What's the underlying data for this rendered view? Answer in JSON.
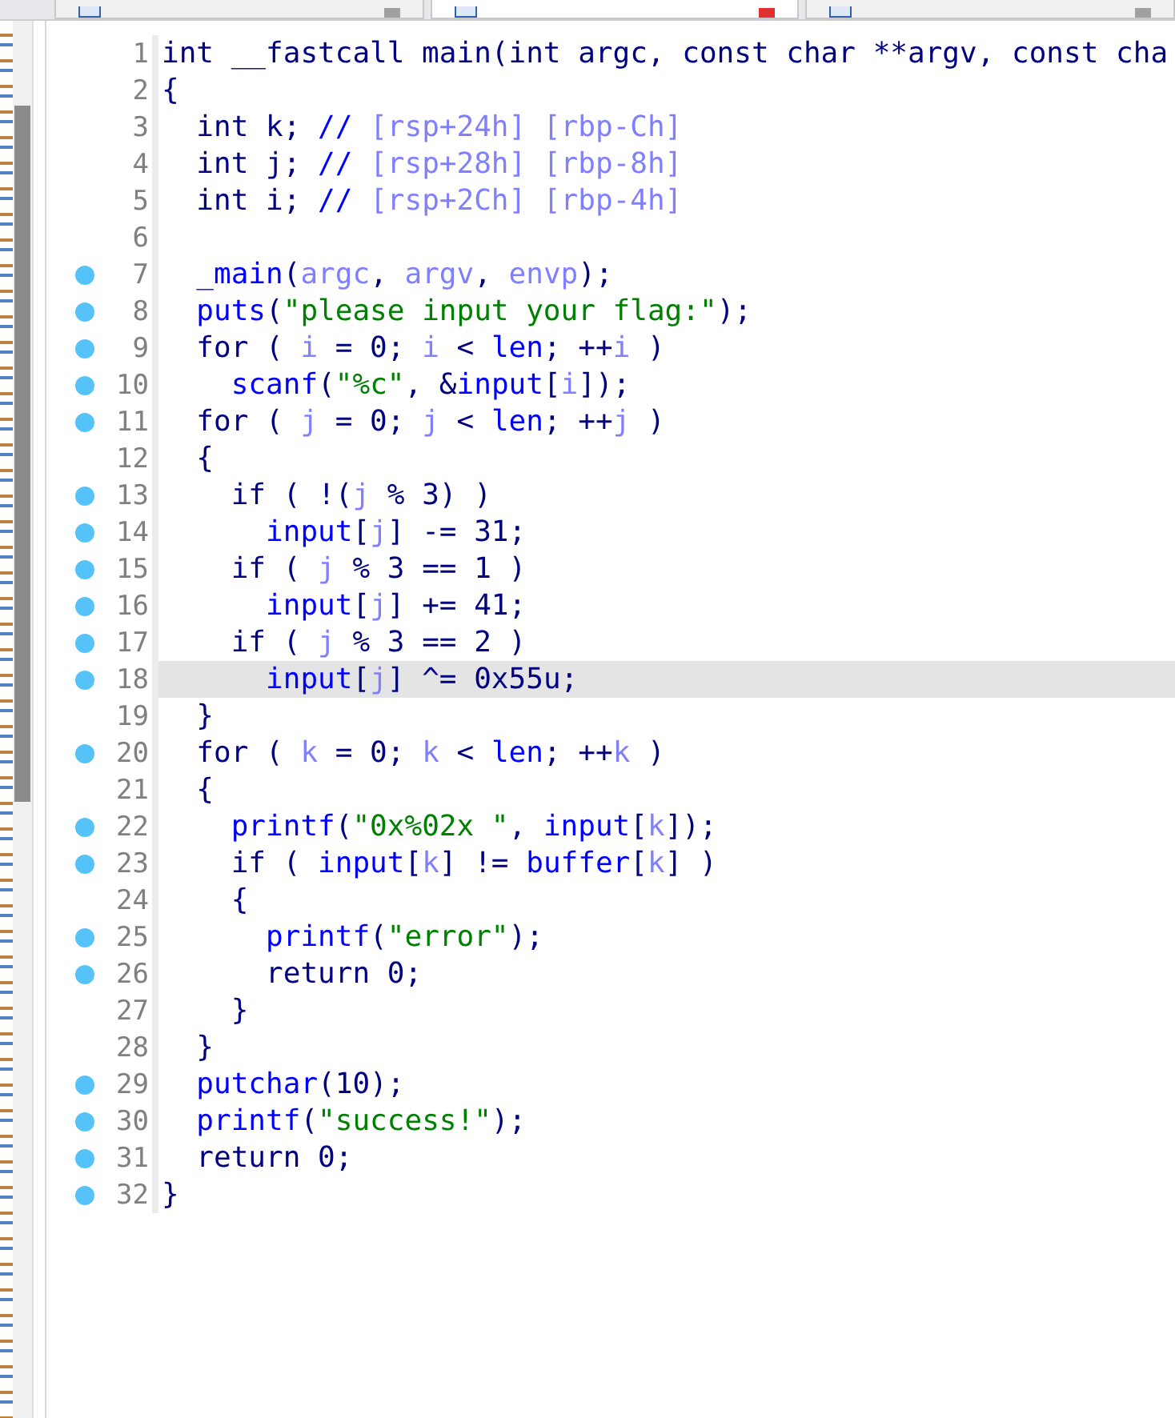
{
  "tabs": [
    {
      "selected": false
    },
    {
      "selected": true
    },
    {
      "selected": false
    }
  ],
  "lines": [
    {
      "number": "1",
      "breakpoint": false,
      "highlighted": false,
      "tokens": [
        {
          "text": "int __fastcall main(int argc, const char **argv, const cha",
          "kind": "plain"
        }
      ]
    },
    {
      "number": "2",
      "breakpoint": false,
      "highlighted": false,
      "tokens": [
        {
          "text": "{",
          "kind": "plain"
        }
      ]
    },
    {
      "number": "3",
      "breakpoint": false,
      "highlighted": false,
      "tokens": [
        {
          "text": "  int k; ",
          "kind": "plain"
        },
        {
          "text": "// ",
          "kind": "func"
        },
        {
          "text": "[rsp+24h] [rbp-Ch]",
          "kind": "var"
        }
      ]
    },
    {
      "number": "4",
      "breakpoint": false,
      "highlighted": false,
      "tokens": [
        {
          "text": "  int j; ",
          "kind": "plain"
        },
        {
          "text": "// ",
          "kind": "func"
        },
        {
          "text": "[rsp+28h] [rbp-8h]",
          "kind": "var"
        }
      ]
    },
    {
      "number": "5",
      "breakpoint": false,
      "highlighted": false,
      "tokens": [
        {
          "text": "  int i; ",
          "kind": "plain"
        },
        {
          "text": "// ",
          "kind": "func"
        },
        {
          "text": "[rsp+2Ch] [rbp-4h]",
          "kind": "var"
        }
      ]
    },
    {
      "number": "6",
      "breakpoint": false,
      "highlighted": false
    },
    {
      "number": "7",
      "breakpoint": true,
      "highlighted": false,
      "tokens": [
        {
          "text": "  _main",
          "kind": "func"
        },
        {
          "text": "(",
          "kind": "plain"
        },
        {
          "text": "argc",
          "kind": "var"
        },
        {
          "text": ", ",
          "kind": "plain"
        },
        {
          "text": "argv",
          "kind": "var"
        },
        {
          "text": ", ",
          "kind": "plain"
        },
        {
          "text": "envp",
          "kind": "var"
        },
        {
          "text": ");",
          "kind": "plain"
        }
      ]
    },
    {
      "number": "8",
      "breakpoint": true,
      "highlighted": false,
      "tokens": [
        {
          "text": "  puts",
          "kind": "func"
        },
        {
          "text": "(",
          "kind": "plain"
        },
        {
          "text": "\"please input your flag:\"",
          "kind": "string"
        },
        {
          "text": ");",
          "kind": "plain"
        }
      ]
    },
    {
      "number": "9",
      "breakpoint": true,
      "highlighted": false,
      "tokens": [
        {
          "text": "  for ( ",
          "kind": "plain"
        },
        {
          "text": "i",
          "kind": "var"
        },
        {
          "text": " = 0; ",
          "kind": "plain"
        },
        {
          "text": "i",
          "kind": "var"
        },
        {
          "text": " < ",
          "kind": "plain"
        },
        {
          "text": "len",
          "kind": "func"
        },
        {
          "text": "; ++",
          "kind": "plain"
        },
        {
          "text": "i",
          "kind": "var"
        },
        {
          "text": " )",
          "kind": "plain"
        }
      ]
    },
    {
      "number": "10",
      "breakpoint": true,
      "highlighted": false,
      "tokens": [
        {
          "text": "    scanf",
          "kind": "func"
        },
        {
          "text": "(",
          "kind": "plain"
        },
        {
          "text": "\"%c\"",
          "kind": "string"
        },
        {
          "text": ", &",
          "kind": "plain"
        },
        {
          "text": "input",
          "kind": "func"
        },
        {
          "text": "[",
          "kind": "plain"
        },
        {
          "text": "i",
          "kind": "var"
        },
        {
          "text": "]);",
          "kind": "plain"
        }
      ]
    },
    {
      "number": "11",
      "breakpoint": true,
      "highlighted": false,
      "tokens": [
        {
          "text": "  for ( ",
          "kind": "plain"
        },
        {
          "text": "j",
          "kind": "var"
        },
        {
          "text": " = 0; ",
          "kind": "plain"
        },
        {
          "text": "j",
          "kind": "var"
        },
        {
          "text": " < ",
          "kind": "plain"
        },
        {
          "text": "len",
          "kind": "func"
        },
        {
          "text": "; ++",
          "kind": "plain"
        },
        {
          "text": "j",
          "kind": "var"
        },
        {
          "text": " )",
          "kind": "plain"
        }
      ]
    },
    {
      "number": "12",
      "breakpoint": false,
      "highlighted": false,
      "tokens": [
        {
          "text": "  {",
          "kind": "plain"
        }
      ]
    },
    {
      "number": "13",
      "breakpoint": true,
      "highlighted": false,
      "tokens": [
        {
          "text": "    if ( !(",
          "kind": "plain"
        },
        {
          "text": "j",
          "kind": "var"
        },
        {
          "text": " % 3) )",
          "kind": "plain"
        }
      ]
    },
    {
      "number": "14",
      "breakpoint": true,
      "highlighted": false,
      "tokens": [
        {
          "text": "      input",
          "kind": "func"
        },
        {
          "text": "[",
          "kind": "plain"
        },
        {
          "text": "j",
          "kind": "var"
        },
        {
          "text": "] -= 31;",
          "kind": "plain"
        }
      ]
    },
    {
      "number": "15",
      "breakpoint": true,
      "highlighted": false,
      "tokens": [
        {
          "text": "    if ( ",
          "kind": "plain"
        },
        {
          "text": "j",
          "kind": "var"
        },
        {
          "text": " % 3 == 1 )",
          "kind": "plain"
        }
      ]
    },
    {
      "number": "16",
      "breakpoint": true,
      "highlighted": false,
      "tokens": [
        {
          "text": "      input",
          "kind": "func"
        },
        {
          "text": "[",
          "kind": "plain"
        },
        {
          "text": "j",
          "kind": "var"
        },
        {
          "text": "] += 41;",
          "kind": "plain"
        }
      ]
    },
    {
      "number": "17",
      "breakpoint": true,
      "highlighted": false,
      "tokens": [
        {
          "text": "    if ( ",
          "kind": "plain"
        },
        {
          "text": "j",
          "kind": "var"
        },
        {
          "text": " % 3 == 2 )",
          "kind": "plain"
        }
      ]
    },
    {
      "number": "18",
      "breakpoint": true,
      "highlighted": true,
      "tokens": [
        {
          "text": "      input",
          "kind": "func"
        },
        {
          "text": "[",
          "kind": "plain"
        },
        {
          "text": "j",
          "kind": "var"
        },
        {
          "text": "] ^= 0x55u;",
          "kind": "plain"
        }
      ]
    },
    {
      "number": "19",
      "breakpoint": false,
      "highlighted": false,
      "tokens": [
        {
          "text": "  }",
          "kind": "plain"
        }
      ]
    },
    {
      "number": "20",
      "breakpoint": true,
      "highlighted": false,
      "tokens": [
        {
          "text": "  for ( ",
          "kind": "plain"
        },
        {
          "text": "k",
          "kind": "var"
        },
        {
          "text": " = 0; ",
          "kind": "plain"
        },
        {
          "text": "k",
          "kind": "var"
        },
        {
          "text": " < ",
          "kind": "plain"
        },
        {
          "text": "len",
          "kind": "func"
        },
        {
          "text": "; ++",
          "kind": "plain"
        },
        {
          "text": "k",
          "kind": "var"
        },
        {
          "text": " )",
          "kind": "plain"
        }
      ]
    },
    {
      "number": "21",
      "breakpoint": false,
      "highlighted": false,
      "tokens": [
        {
          "text": "  {",
          "kind": "plain"
        }
      ]
    },
    {
      "number": "22",
      "breakpoint": true,
      "highlighted": false,
      "tokens": [
        {
          "text": "    printf",
          "kind": "func"
        },
        {
          "text": "(",
          "kind": "plain"
        },
        {
          "text": "\"0x%02x \"",
          "kind": "string"
        },
        {
          "text": ", ",
          "kind": "plain"
        },
        {
          "text": "input",
          "kind": "func"
        },
        {
          "text": "[",
          "kind": "plain"
        },
        {
          "text": "k",
          "kind": "var"
        },
        {
          "text": "]);",
          "kind": "plain"
        }
      ]
    },
    {
      "number": "23",
      "breakpoint": true,
      "highlighted": false,
      "tokens": [
        {
          "text": "    if ( ",
          "kind": "plain"
        },
        {
          "text": "input",
          "kind": "func"
        },
        {
          "text": "[",
          "kind": "plain"
        },
        {
          "text": "k",
          "kind": "var"
        },
        {
          "text": "] != ",
          "kind": "plain"
        },
        {
          "text": "buffer",
          "kind": "func"
        },
        {
          "text": "[",
          "kind": "plain"
        },
        {
          "text": "k",
          "kind": "var"
        },
        {
          "text": "] )",
          "kind": "plain"
        }
      ]
    },
    {
      "number": "24",
      "breakpoint": false,
      "highlighted": false,
      "tokens": [
        {
          "text": "    {",
          "kind": "plain"
        }
      ]
    },
    {
      "number": "25",
      "breakpoint": true,
      "highlighted": false,
      "tokens": [
        {
          "text": "      printf",
          "kind": "func"
        },
        {
          "text": "(",
          "kind": "plain"
        },
        {
          "text": "\"error\"",
          "kind": "string"
        },
        {
          "text": ");",
          "kind": "plain"
        }
      ]
    },
    {
      "number": "26",
      "breakpoint": true,
      "highlighted": false,
      "tokens": [
        {
          "text": "      return 0;",
          "kind": "plain"
        }
      ]
    },
    {
      "number": "27",
      "breakpoint": false,
      "highlighted": false,
      "tokens": [
        {
          "text": "    }",
          "kind": "plain"
        }
      ]
    },
    {
      "number": "28",
      "breakpoint": false,
      "highlighted": false,
      "tokens": [
        {
          "text": "  }",
          "kind": "plain"
        }
      ]
    },
    {
      "number": "29",
      "breakpoint": true,
      "highlighted": false,
      "tokens": [
        {
          "text": "  putchar",
          "kind": "func"
        },
        {
          "text": "(10);",
          "kind": "plain"
        }
      ]
    },
    {
      "number": "30",
      "breakpoint": true,
      "highlighted": false,
      "tokens": [
        {
          "text": "  printf",
          "kind": "func"
        },
        {
          "text": "(",
          "kind": "plain"
        },
        {
          "text": "\"success!\"",
          "kind": "string"
        },
        {
          "text": ");",
          "kind": "plain"
        }
      ]
    },
    {
      "number": "31",
      "breakpoint": true,
      "highlighted": false,
      "tokens": [
        {
          "text": "  return 0;",
          "kind": "plain"
        }
      ]
    },
    {
      "number": "32",
      "breakpoint": true,
      "highlighted": false,
      "tokens": [
        {
          "text": "}",
          "kind": "plain"
        }
      ]
    }
  ]
}
